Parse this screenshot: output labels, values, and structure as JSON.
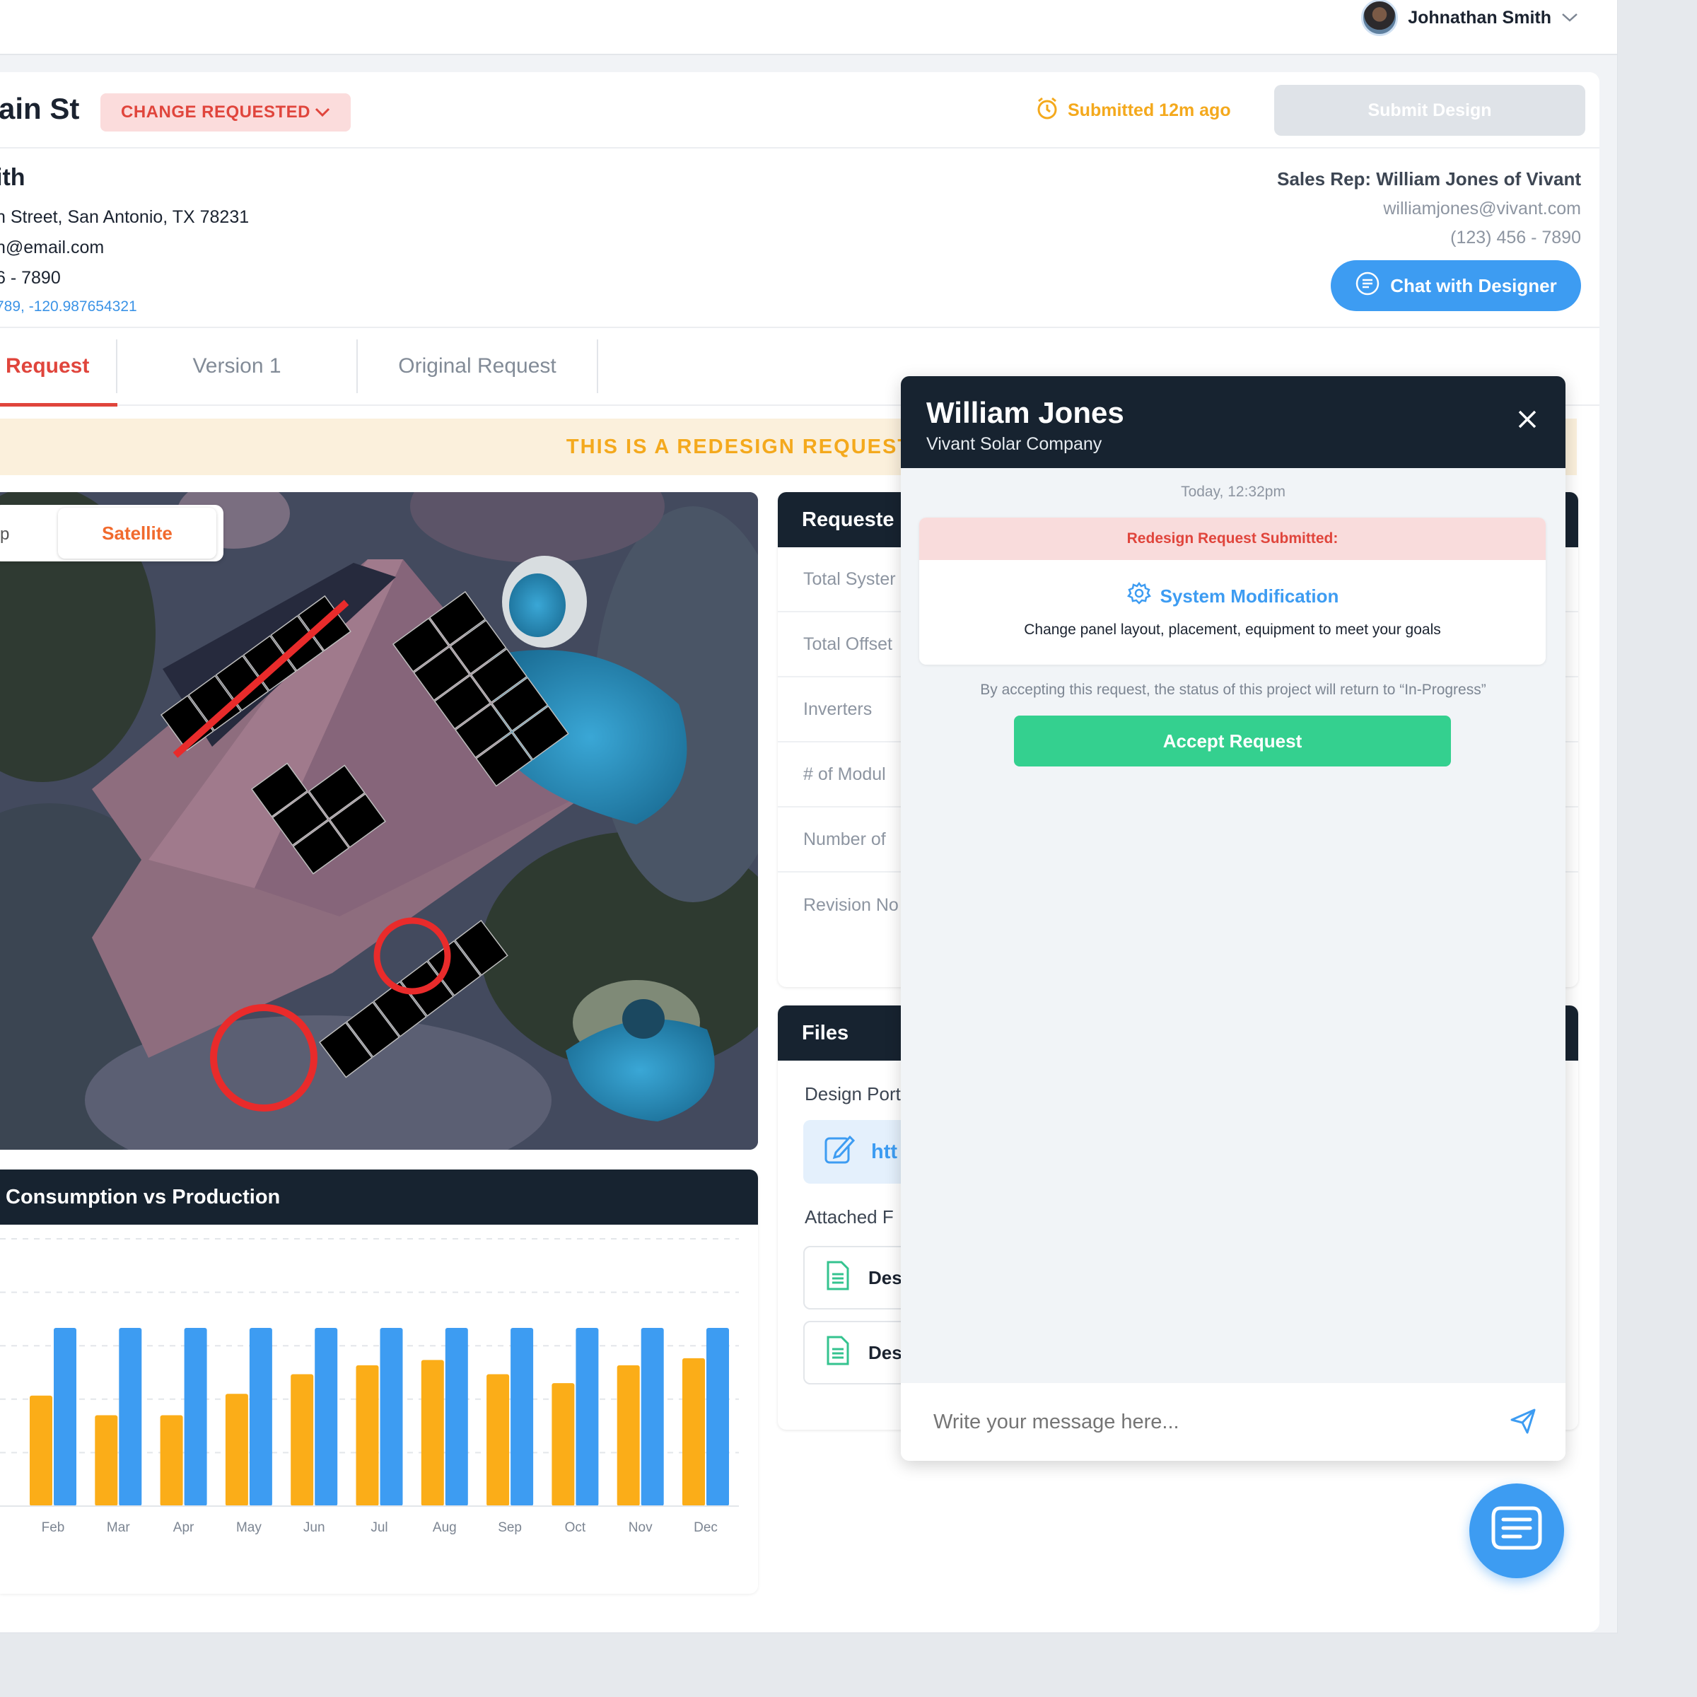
{
  "topbar": {
    "user_name": "Johnathan Smith"
  },
  "project": {
    "street": "ain St",
    "status": "CHANGE REQUESTED",
    "submitted": "Submitted 12m ago",
    "submit_label": "Submit Design"
  },
  "customer": {
    "name": "ith",
    "address": "n Street, San Antonio, TX 78231",
    "email": "h@email.com",
    "phone": "6 - 7890",
    "coords": "789, -120.987654321"
  },
  "sales_rep": {
    "title": "Sales Rep: William Jones of Vivant",
    "email": "williamjones@vivant.com",
    "phone": "(123) 456 - 7890",
    "chat_label": "Chat with Designer"
  },
  "tabs": [
    {
      "label": "Request",
      "active": true
    },
    {
      "label": "Version 1",
      "active": false
    },
    {
      "label": "Original Request",
      "active": false
    }
  ],
  "banner": "THIS IS A REDESIGN REQUEST",
  "map": {
    "left_option": "p",
    "active_option": "Satellite"
  },
  "requested": {
    "title": "Requeste",
    "rows": [
      "Total Syster",
      "Total Offset",
      "Inverters",
      "# of Modul",
      "Number of",
      "Revision No"
    ]
  },
  "files": {
    "title": "Files",
    "portal_label": "Design Port",
    "portal_link": "htt",
    "attached_label": "Attached F",
    "items": [
      "Des",
      "Des"
    ]
  },
  "chart_data": {
    "type": "bar",
    "title": "Consumption vs Production",
    "categories": [
      "Feb",
      "Mar",
      "Apr",
      "May",
      "Jun",
      "Jul",
      "Aug",
      "Sep",
      "Oct",
      "Nov",
      "Dec"
    ],
    "series": [
      {
        "values": [
          62,
          51,
          51,
          63,
          74,
          79,
          82,
          74,
          69,
          79,
          83
        ]
      },
      {
        "values": [
          100,
          100,
          100,
          100,
          100,
          100,
          100,
          100,
          100,
          100,
          100
        ]
      }
    ],
    "ylim": [
      0,
      150
    ],
    "grid": true,
    "colors": [
      "#fbad18",
      "#3d9cf2"
    ]
  },
  "chat": {
    "name": "William Jones",
    "company": "Vivant Solar Company",
    "time": "Today, 12:32pm",
    "message_header": "Redesign Request Submitted:",
    "message_title": "System Modification",
    "message_desc": "Change panel layout, placement, equipment to meet your goals",
    "note": "By accepting this request, the status of this project will return to “In-Progress”",
    "accept_label": "Accept Request",
    "input_placeholder": "Write your message here..."
  },
  "colors": {
    "accent_blue": "#3d9cf2",
    "accent_red": "#e0453c",
    "accent_orange": "#f4a91d",
    "accent_green": "#34d08f",
    "dark_header": "#172330"
  }
}
